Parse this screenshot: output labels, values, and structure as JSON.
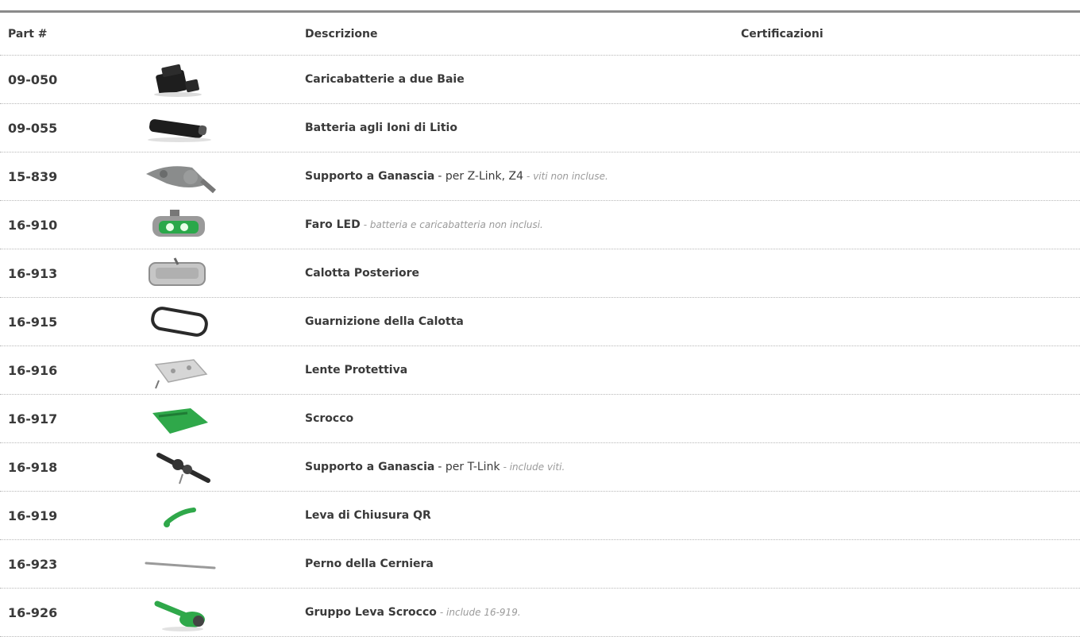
{
  "header": {
    "part_label": "Part #",
    "description_label": "Descrizione",
    "certifications_label": "Certificazioni"
  },
  "parts": [
    {
      "part": "09-050",
      "icon": "dual-bay-charger-icon",
      "title": "Caricabatterie a due Baie",
      "detail": "",
      "note": ""
    },
    {
      "part": "09-055",
      "icon": "lithium-battery-icon",
      "title": "Batteria agli Ioni di Litio",
      "detail": "",
      "note": ""
    },
    {
      "part": "15-839",
      "icon": "clamp-mount-icon",
      "title": "Supporto a Ganascia",
      "detail": "- per Z-Link, Z4",
      "note": "- viti non incluse."
    },
    {
      "part": "16-910",
      "icon": "led-headlight-icon",
      "title": "Faro LED",
      "detail": "",
      "note": "- batteria e caricabatteria non inclusi."
    },
    {
      "part": "16-913",
      "icon": "rear-housing-icon",
      "title": "Calotta Posteriore",
      "detail": "",
      "note": ""
    },
    {
      "part": "16-915",
      "icon": "housing-gasket-icon",
      "title": "Guarnizione della Calotta",
      "detail": "",
      "note": ""
    },
    {
      "part": "16-916",
      "icon": "protective-lens-icon",
      "title": "Lente Protettiva",
      "detail": "",
      "note": ""
    },
    {
      "part": "16-917",
      "icon": "latch-icon",
      "title": "Scrocco",
      "detail": "",
      "note": ""
    },
    {
      "part": "16-918",
      "icon": "t-link-mount-icon",
      "title": "Supporto a Ganascia",
      "detail": "- per T-Link",
      "note": "- include viti."
    },
    {
      "part": "16-919",
      "icon": "qr-lever-icon",
      "title": "Leva di Chiusura QR",
      "detail": "",
      "note": ""
    },
    {
      "part": "16-923",
      "icon": "hinge-pin-icon",
      "title": "Perno della Cerniera",
      "detail": "",
      "note": ""
    },
    {
      "part": "16-926",
      "icon": "latch-lever-assembly-icon",
      "title": "Gruppo Leva Scrocco",
      "detail": "",
      "note": "- include 16-919."
    }
  ]
}
